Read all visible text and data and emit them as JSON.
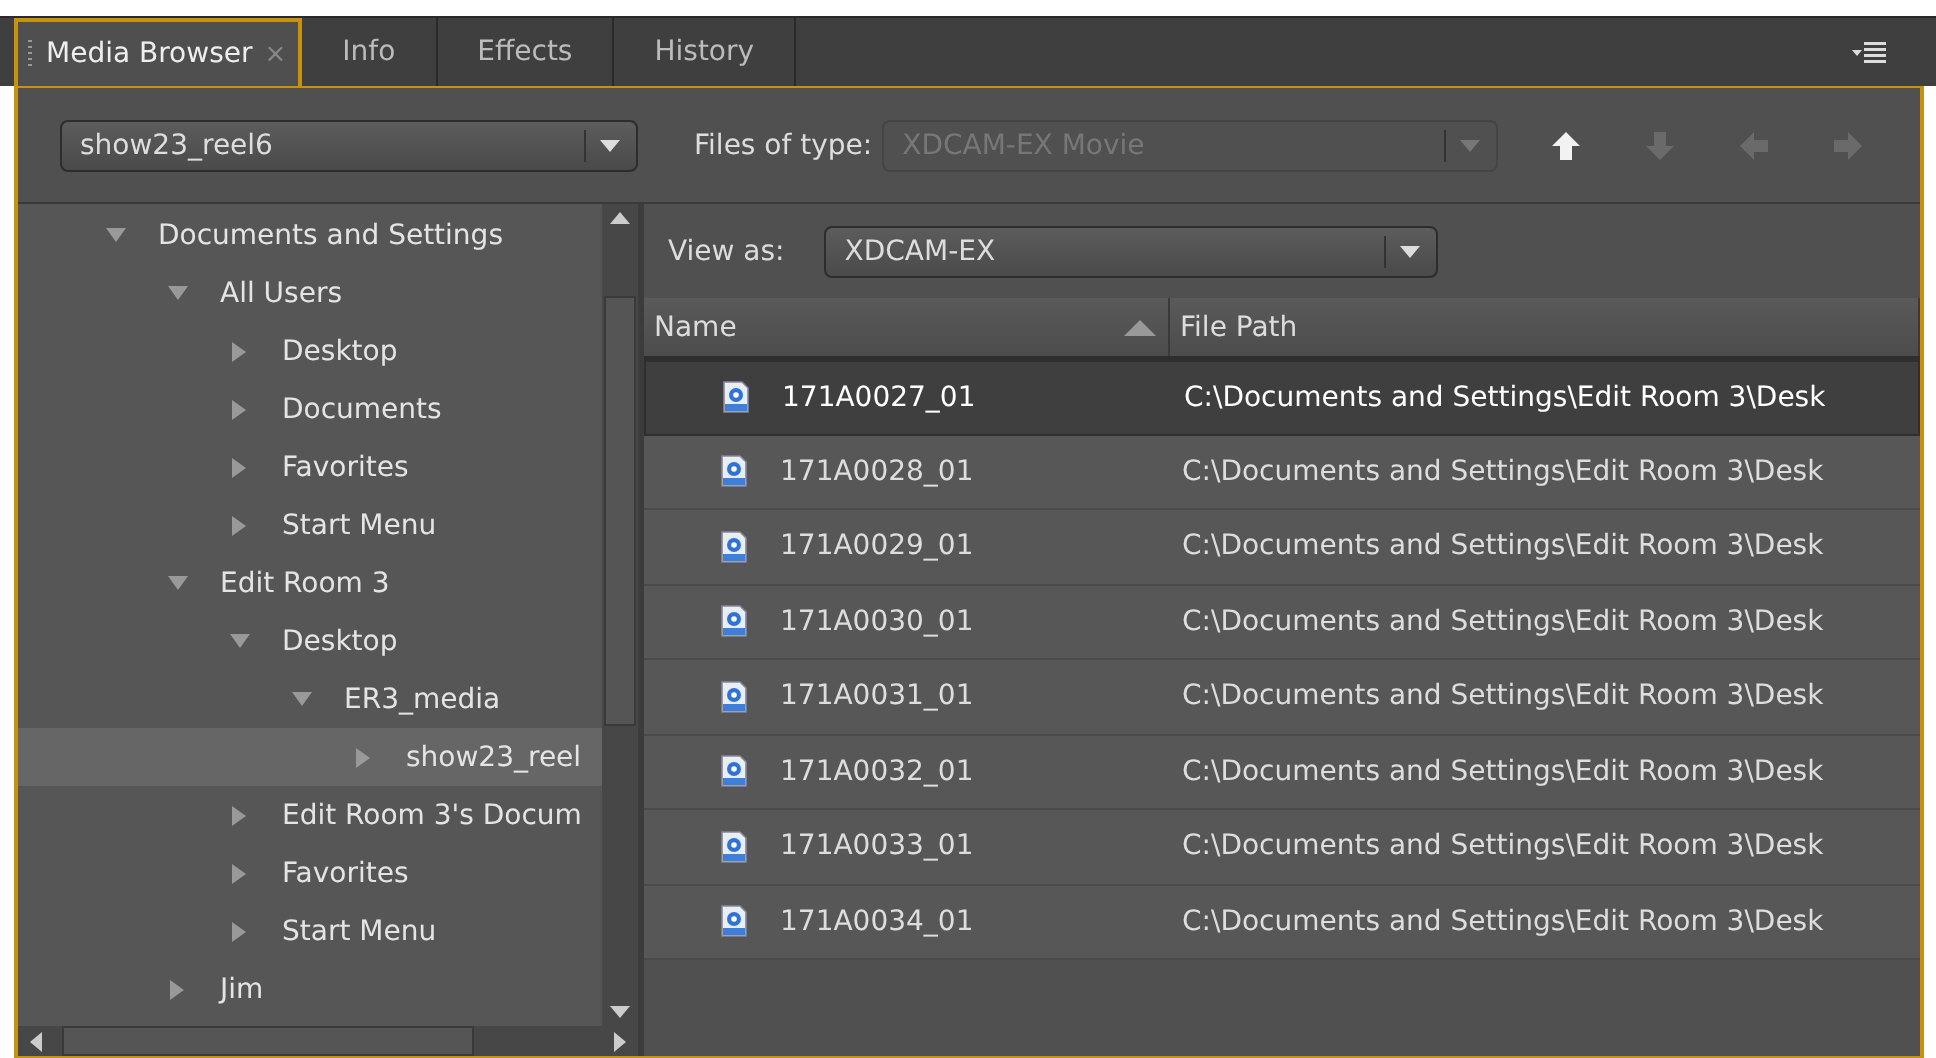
{
  "tabs": [
    {
      "label": "Media Browser",
      "selected": true,
      "close": "×"
    },
    {
      "label": "Info",
      "selected": false
    },
    {
      "label": "Effects",
      "selected": false
    },
    {
      "label": "History",
      "selected": false
    }
  ],
  "toolbar": {
    "location": "show23_reel6",
    "files_of_type": {
      "label": "Files of type:",
      "value": "XDCAM-EX Movie",
      "disabled": true
    },
    "nav_buttons": [
      {
        "kind": "up",
        "disabled": false
      },
      {
        "kind": "down",
        "disabled": true
      },
      {
        "kind": "back",
        "disabled": true
      },
      {
        "kind": "forward",
        "disabled": true
      }
    ]
  },
  "tree": [
    {
      "label": "Documents and Settings",
      "expanded": true,
      "selected": false,
      "children": [
        {
          "label": "All Users",
          "expanded": true,
          "selected": false,
          "children": [
            {
              "label": "Desktop",
              "expanded": false,
              "selected": false
            },
            {
              "label": "Documents",
              "expanded": false,
              "selected": false
            },
            {
              "label": "Favorites",
              "expanded": false,
              "selected": false
            },
            {
              "label": "Start Menu",
              "expanded": false,
              "selected": false
            }
          ]
        },
        {
          "label": "Edit Room 3",
          "expanded": true,
          "selected": false,
          "children": [
            {
              "label": "Desktop",
              "expanded": true,
              "selected": false,
              "children": [
                {
                  "label": "ER3_media",
                  "expanded": true,
                  "selected": false,
                  "children": [
                    {
                      "label": "show23_reel",
                      "expanded": false,
                      "selected": true
                    }
                  ]
                }
              ]
            },
            {
              "label": "Edit Room 3's Docum",
              "expanded": false,
              "selected": false
            },
            {
              "label": "Favorites",
              "expanded": false,
              "selected": false
            },
            {
              "label": "Start Menu",
              "expanded": false,
              "selected": false
            }
          ]
        },
        {
          "label": "Jim",
          "expanded": false,
          "selected": false
        }
      ]
    }
  ],
  "view_as": {
    "label": "View as:",
    "value": "XDCAM-EX"
  },
  "table": {
    "columns": [
      {
        "label": "Name",
        "sorted": true
      },
      {
        "label": "File Path"
      }
    ],
    "rows": [
      {
        "name": "171A0027_01",
        "path": "C:\\Documents and Settings\\Edit Room 3\\Desk",
        "selected": true
      },
      {
        "name": "171A0028_01",
        "path": "C:\\Documents and Settings\\Edit Room 3\\Desk",
        "selected": false
      },
      {
        "name": "171A0029_01",
        "path": "C:\\Documents and Settings\\Edit Room 3\\Desk",
        "selected": false
      },
      {
        "name": "171A0030_01",
        "path": "C:\\Documents and Settings\\Edit Room 3\\Desk",
        "selected": false
      },
      {
        "name": "171A0031_01",
        "path": "C:\\Documents and Settings\\Edit Room 3\\Desk",
        "selected": false
      },
      {
        "name": "171A0032_01",
        "path": "C:\\Documents and Settings\\Edit Room 3\\Desk",
        "selected": false
      },
      {
        "name": "171A0033_01",
        "path": "C:\\Documents and Settings\\Edit Room 3\\Desk",
        "selected": false
      },
      {
        "name": "171A0034_01",
        "path": "C:\\Documents and Settings\\Edit Room 3\\Desk",
        "selected": false
      }
    ]
  }
}
